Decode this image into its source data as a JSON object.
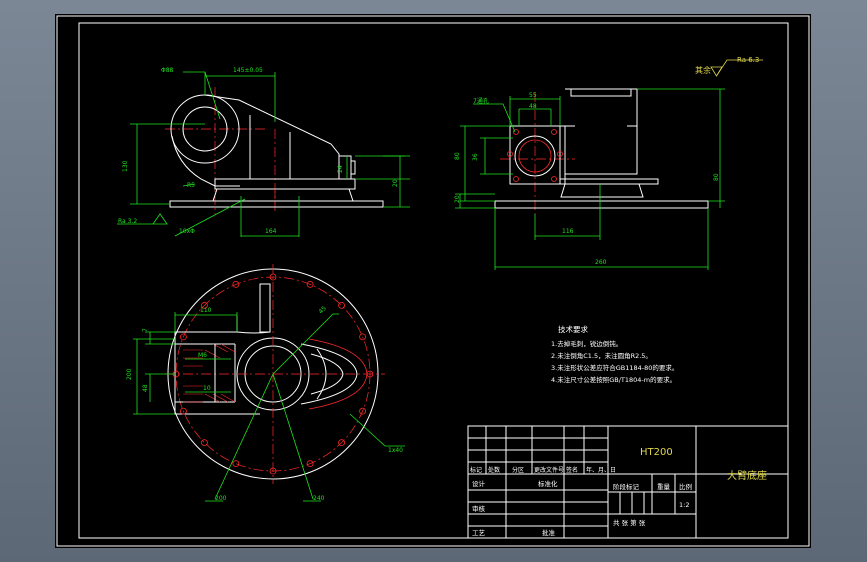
{
  "roughness_note": {
    "prefix": "其余",
    "value": "Ra 6.3"
  },
  "dims": {
    "top": {
      "d1": "Φ88",
      "d2": "145±0.05",
      "d3": "20",
      "d4": "24",
      "d5": "R5",
      "d6": "130",
      "d7": "164",
      "ra": "Ra 3.2",
      "thread": "10xΦ"
    },
    "side": {
      "d1": "7通孔",
      "d2": "55",
      "d3": "48",
      "d4": "80",
      "d5": "36",
      "d6": "20",
      "d7": "116",
      "d8": "80",
      "d9": "260"
    },
    "bottom": {
      "d1": "110",
      "d2": "7",
      "d3": "M6",
      "d4": "10",
      "d5": "45",
      "d6": "200",
      "d7": "240",
      "d8": "1x40",
      "d9": "48"
    }
  },
  "notes": {
    "title": "技术要求",
    "items": [
      "1.去掉毛刺，锐边倒钝。",
      "2.未注倒角C1.5，未注圆角R2.5。",
      "3.未注形状公差应符合GB1184-80的要求。",
      "4.未注尺寸公差按照GB/T1804-m的要求。"
    ]
  },
  "title_block": {
    "material": "HT200",
    "part_name": "大臂底座",
    "scale_label": "比例",
    "scale": "1:2",
    "weight_label": "重量",
    "stage_label": "阶段标记",
    "sheet_total": "共   张  第   张",
    "rev_headers": [
      "标记",
      "处数",
      "分区",
      "更改文件号",
      "签名",
      "年、月、日"
    ],
    "roles": [
      "设计",
      "标准化",
      "审核",
      "工艺",
      "批准"
    ]
  }
}
